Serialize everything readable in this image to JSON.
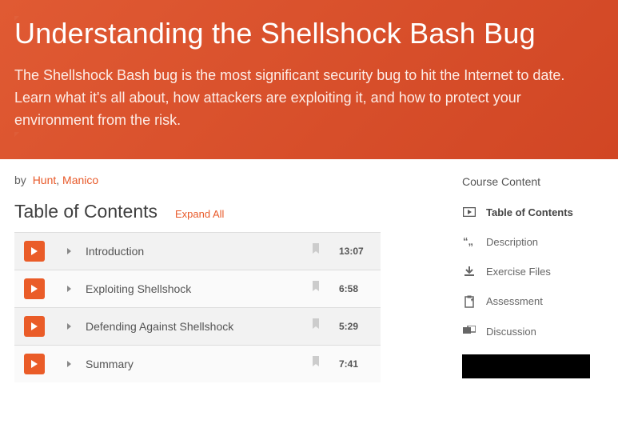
{
  "hero": {
    "title": "Understanding the Shellshock Bash Bug",
    "subtitle": "The Shellshock Bash bug is the most significant security bug to hit the Internet to date. Learn what it's all about, how attackers are exploiting it, and how to protect your environment from the risk."
  },
  "byline": {
    "by": "by",
    "author1": "Hunt",
    "sep": ",",
    "author2": "Manico"
  },
  "toc": {
    "heading": "Table of Contents",
    "expand": "Expand All",
    "rows": [
      {
        "title": "Introduction",
        "duration": "13:07"
      },
      {
        "title": "Exploiting Shellshock",
        "duration": "6:58"
      },
      {
        "title": "Defending Against Shellshock",
        "duration": "5:29"
      },
      {
        "title": "Summary",
        "duration": "7:41"
      }
    ]
  },
  "sidebar": {
    "title": "Course Content",
    "items": [
      {
        "label": "Table of Contents",
        "icon": "play-box",
        "active": true
      },
      {
        "label": "Description",
        "icon": "quotes",
        "active": false
      },
      {
        "label": "Exercise Files",
        "icon": "download",
        "active": false
      },
      {
        "label": "Assessment",
        "icon": "clipboard",
        "active": false
      },
      {
        "label": "Discussion",
        "icon": "discussion",
        "active": false
      }
    ]
  }
}
